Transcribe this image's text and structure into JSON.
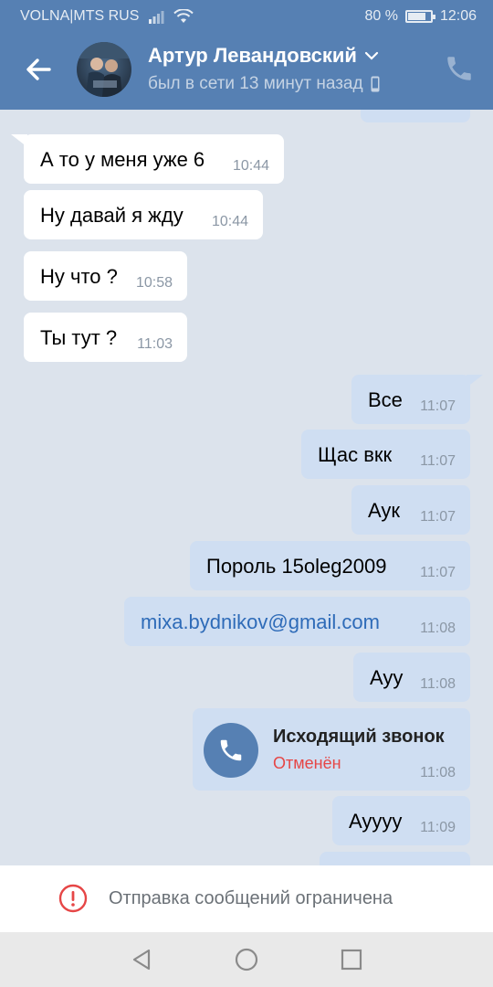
{
  "status_bar": {
    "carrier": "VOLNA|MTS RUS",
    "battery": "80 %",
    "battery_level": 0.8,
    "time": "12:06"
  },
  "header": {
    "contact_name": "Артур Левандовский",
    "last_seen": "был в сети 13 минут назад",
    "icons": [
      "back-arrow-icon",
      "chevron-down-icon",
      "mobile-device-icon",
      "phone-icon"
    ]
  },
  "messages": [
    {
      "text": "А то у меня уже 6",
      "time": "10:44",
      "dir": "in"
    },
    {
      "text": "Ну давай я жду",
      "time": "10:44",
      "dir": "in"
    },
    {
      "text": "Ну что ?",
      "time": "10:58",
      "dir": "in"
    },
    {
      "text": "Ты тут ?",
      "time": "11:03",
      "dir": "in"
    },
    {
      "text": "Все",
      "time": "11:07",
      "dir": "out"
    },
    {
      "text": "Щас вкк",
      "time": "11:07",
      "dir": "out"
    },
    {
      "text": "Аук",
      "time": "11:07",
      "dir": "out"
    },
    {
      "text": "Пороль 15oleg2009",
      "time": "11:07",
      "dir": "out"
    },
    {
      "text": "mixa.bydnikov@gmail.com",
      "time": "11:08",
      "dir": "out",
      "link": true
    },
    {
      "text": "Ауу",
      "time": "11:08",
      "dir": "out"
    },
    {
      "call_title": "Исходящий звонок",
      "call_status": "Отменён",
      "time": "11:08",
      "dir": "out"
    },
    {
      "text": "Ауууу",
      "time": "11:09",
      "dir": "out"
    }
  ],
  "restriction": {
    "text": "Отправка сообщений ограничена",
    "icon": "alert-circle-icon"
  },
  "navbar": {
    "icons": [
      "nav-back-icon",
      "nav-home-icon",
      "nav-recents-icon"
    ]
  },
  "colors": {
    "header": "#5680b3",
    "chat_background": "#dce3ec",
    "incoming_bubble": "#ffffff",
    "outgoing_bubble": "#cfdef2",
    "link": "#2e6bb8",
    "cancelled": "#e64646"
  }
}
